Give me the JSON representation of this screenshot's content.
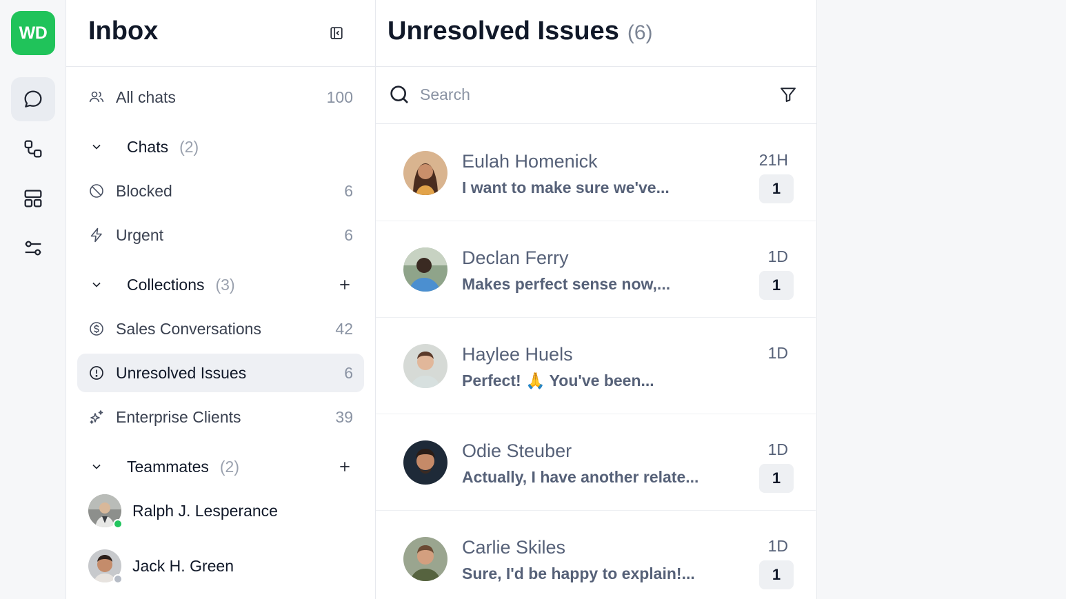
{
  "rail": {
    "logo": "WD",
    "items": [
      {
        "name": "chat-bubble-icon",
        "active": true
      },
      {
        "name": "workflow-icon",
        "active": false
      },
      {
        "name": "layout-icon",
        "active": false
      },
      {
        "name": "settings-sliders-icon",
        "active": false
      }
    ]
  },
  "sidebar": {
    "title": "Inbox",
    "all_chats": {
      "label": "All chats",
      "count": "100"
    },
    "chats_group": {
      "label": "Chats",
      "count": "(2)"
    },
    "blocked": {
      "label": "Blocked",
      "count": "6"
    },
    "urgent": {
      "label": "Urgent",
      "count": "6"
    },
    "collections_group": {
      "label": "Collections",
      "count": "(3)"
    },
    "sales": {
      "label": "Sales Conversations",
      "count": "42"
    },
    "unresolved": {
      "label": "Unresolved Issues",
      "count": "6"
    },
    "enterprise": {
      "label": "Enterprise Clients",
      "count": "39"
    },
    "teammates_group": {
      "label": "Teammates",
      "count": "(2)"
    },
    "teammates": [
      {
        "name": "Ralph J. Lesperance",
        "status": "online",
        "status_color": "#22c55e"
      },
      {
        "name": "Jack H. Green",
        "status": "offline",
        "status_color": "#b6bcc6"
      }
    ]
  },
  "list": {
    "title": "Unresolved Issues",
    "count": "(6)",
    "search": {
      "placeholder": "Search",
      "value": ""
    },
    "conversations": [
      {
        "name": "Eulah Homenick",
        "preview": "I want to make sure we've...",
        "time": "21H",
        "unread": "1"
      },
      {
        "name": "Declan Ferry",
        "preview": "Makes perfect sense now,...",
        "time": "1D",
        "unread": "1"
      },
      {
        "name": "Haylee Huels",
        "preview": "Perfect! 🙏 You've been...",
        "time": "1D",
        "unread": ""
      },
      {
        "name": "Odie Steuber",
        "preview": "Actually, I have another relate...",
        "time": "1D",
        "unread": "1"
      },
      {
        "name": "Carlie Skiles",
        "preview": "Sure, I'd be happy to explain!...",
        "time": "1D",
        "unread": "1"
      }
    ]
  },
  "colors": {
    "accent": "#20c35a",
    "online": "#22c55e",
    "active_bg": "#eef0f4"
  }
}
